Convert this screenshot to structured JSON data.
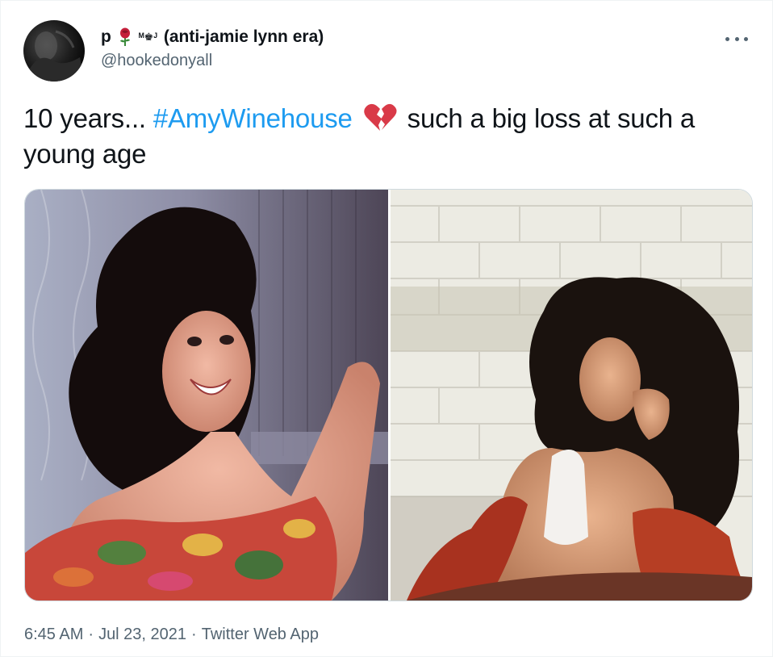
{
  "tweet": {
    "author": {
      "name_initial": "p",
      "name_emoji": "rose",
      "name_tag": "ᴹ♚ᴶ",
      "name_suffix": "(anti-jamie lynn era)",
      "handle": "@hookedonyall",
      "avatar_icon": "avatar-photo"
    },
    "menu_icon": "more-horizontal-icon",
    "text": {
      "line_prefix": "10 years... ",
      "hashtag": "#AmyWinehouse",
      "emoji": "broken-heart",
      "line_suffix": " such a big loss at such a young age"
    },
    "media": [
      {
        "alt": "photo-1"
      },
      {
        "alt": "photo-2"
      }
    ],
    "meta": {
      "time": "6:45 AM",
      "date": "Jul 23, 2021",
      "separator": "·",
      "source": "Twitter Web App"
    }
  },
  "colors": {
    "link": "#1d9bf0",
    "secondary_text": "#536471",
    "heart": "#d93a48",
    "rose": "#c41e3a"
  }
}
